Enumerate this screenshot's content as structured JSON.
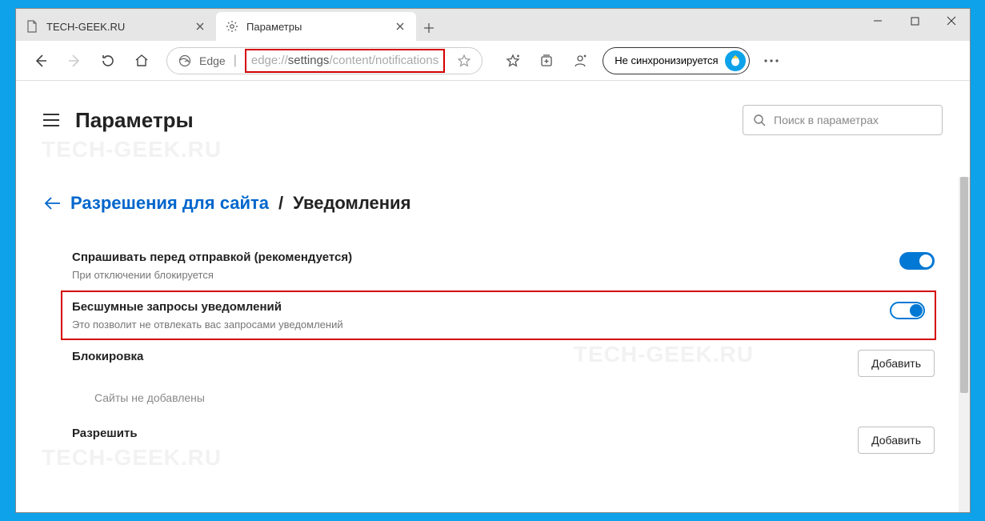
{
  "window": {
    "tabs": [
      {
        "title": "TECH-GEEK.RU",
        "active": false
      },
      {
        "title": "Параметры",
        "active": true
      }
    ]
  },
  "toolbar": {
    "edge_label": "Edge",
    "url_segments": [
      "edge://",
      "settings",
      "/",
      "content",
      "/",
      "notifications"
    ],
    "sync_label": "Не синхронизируется"
  },
  "page": {
    "title": "Параметры",
    "search_placeholder": "Поиск в параметрах",
    "breadcrumb": {
      "link": "Разрешения для сайта",
      "sep": "/",
      "current": "Уведомления"
    },
    "settings": {
      "ask": {
        "title": "Спрашивать перед отправкой (рекомендуется)",
        "sub": "При отключении блокируется"
      },
      "quiet": {
        "title": "Бесшумные запросы уведомлений",
        "sub": "Это позволит не отвлекать вас запросами уведомлений"
      },
      "block": {
        "title": "Блокировка",
        "empty": "Сайты не добавлены",
        "add": "Добавить"
      },
      "allow": {
        "title": "Разрешить",
        "add": "Добавить"
      }
    }
  },
  "watermark": "TECH-GEEK.RU"
}
